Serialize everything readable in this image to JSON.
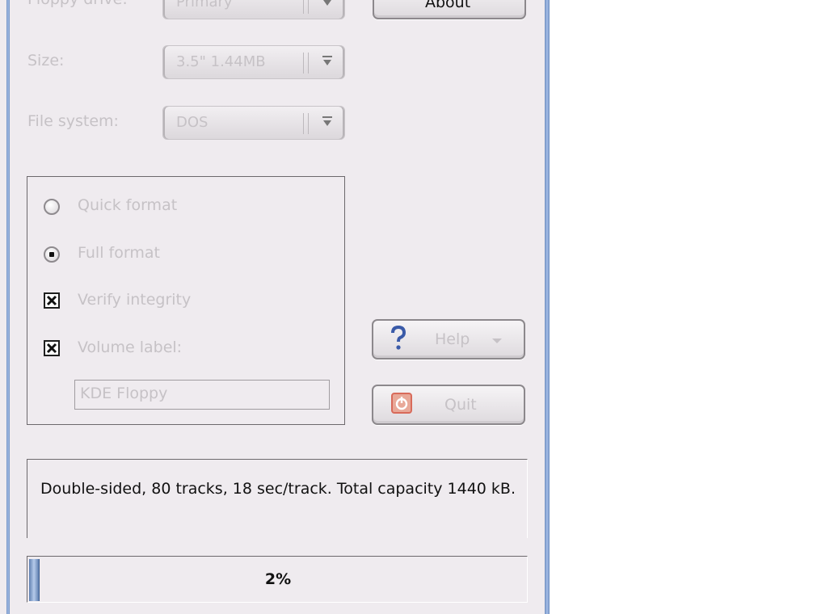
{
  "form": {
    "floppy_drive_label": "Floppy drive:",
    "floppy_drive_value": "Primary",
    "size_label": "Size:",
    "size_value": "3.5\" 1.44MB",
    "file_system_label": "File system:",
    "file_system_value": "DOS"
  },
  "options": {
    "quick_format_label": "Quick format",
    "quick_format_selected": false,
    "full_format_label": "Full format",
    "full_format_selected": true,
    "verify_integrity_label": "Verify integrity",
    "verify_integrity_checked": true,
    "volume_label_label": "Volume label:",
    "volume_label_checked": true,
    "volume_label_value": "KDE Floppy"
  },
  "buttons": {
    "about_label": "About",
    "help_label": "Help",
    "quit_label": "Quit"
  },
  "info": {
    "text": "Double-sided, 80 tracks, 18 sec/track. Total capacity 1440 kB."
  },
  "progress": {
    "value_percent": 2,
    "label": "2%"
  },
  "colors": {
    "window_bg": "#efebef",
    "frame_blue": "#6f8fbf",
    "disabled_text": "#c6c2c6",
    "help_icon_blue": "#3a5aa8",
    "quit_icon_red": "#d86a5a"
  }
}
